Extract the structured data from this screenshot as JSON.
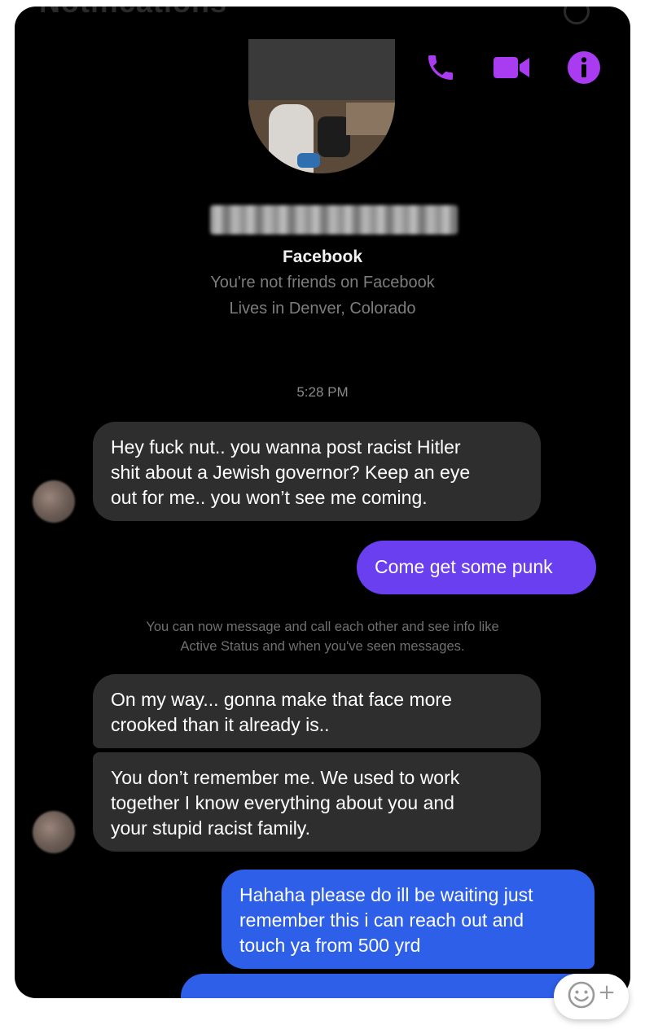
{
  "header": {
    "title": "Notifications"
  },
  "top_actions": {
    "icons": [
      "phone-icon",
      "video-camera-icon",
      "info-icon"
    ],
    "accent_color": "#a93cf0"
  },
  "profile": {
    "platform_label": "Facebook",
    "friend_status": "You're not friends on Facebook",
    "location": "Lives in Denver, Colorado"
  },
  "conversation": {
    "timestamp": "5:28 PM",
    "messages": [
      {
        "direction": "incoming",
        "text": "Hey fuck nut.. you wanna post racist Hitler\nshit about a Jewish governor? Keep an eye\nout for me.. you won’t see me coming."
      },
      {
        "direction": "outgoing",
        "text": "Come get some punk",
        "color": "#6a3ff0"
      },
      {
        "direction": "incoming",
        "text": "On my way... gonna make that face more\ncrooked than it already is.."
      },
      {
        "direction": "incoming",
        "text": "You don’t remember me. We used to work\ntogether I know everything about you and\nyour stupid racist family."
      },
      {
        "direction": "outgoing",
        "text": "Hahaha please do ill be waiting just\nremember this i can reach out and\ntouch ya from 500 yrd",
        "color": "#2d5fe8"
      },
      {
        "direction": "outgoing",
        "text": "",
        "color": "#2d5fe8"
      }
    ],
    "system_note": "You can now message and call each other and see info like\nActive Status and when you've seen messages."
  },
  "reaction_button": {
    "icon": "smiley-add-icon",
    "plus_label": "+"
  }
}
